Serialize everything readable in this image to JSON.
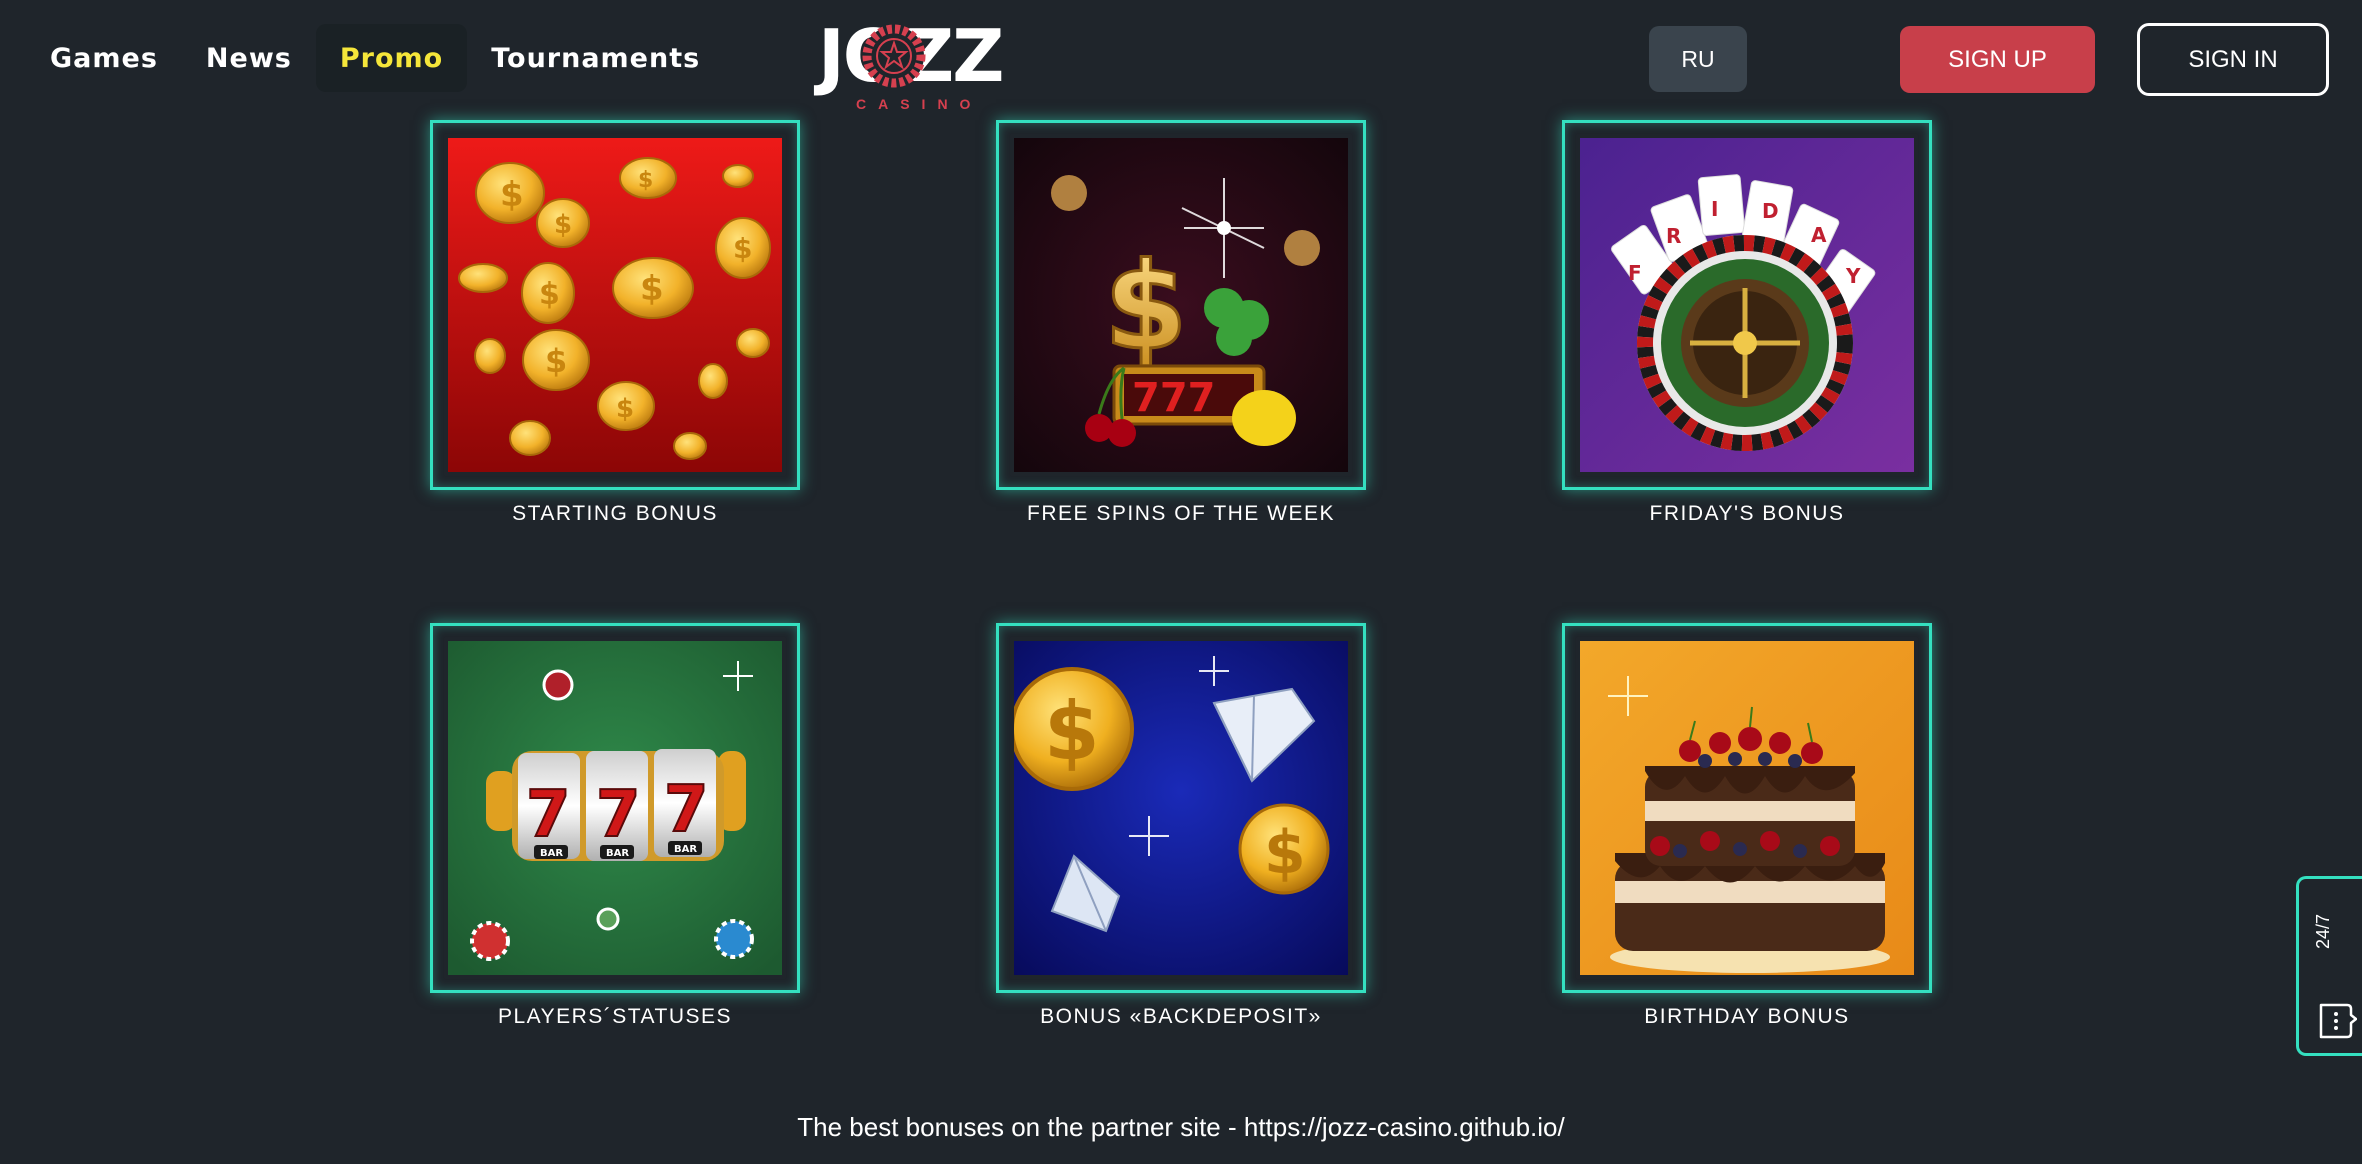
{
  "nav": {
    "items": [
      {
        "label": "Games",
        "active": false
      },
      {
        "label": "News",
        "active": false
      },
      {
        "label": "Promo",
        "active": true
      },
      {
        "label": "Tournaments",
        "active": false
      }
    ]
  },
  "logo": {
    "word": "JOZZ",
    "sub": "CASINO"
  },
  "header": {
    "language_label": "RU",
    "signup_label": "SIGN UP",
    "signin_label": "SIGN IN"
  },
  "promos": [
    {
      "title": "STARTING BONUS",
      "icon": "gold-coins-icon"
    },
    {
      "title": "FREE SPINS OF THE WEEK",
      "icon": "slot-dollar-icon"
    },
    {
      "title": "FRIDAY'S BONUS",
      "icon": "roulette-cards-icon"
    },
    {
      "title": "PLAYERS´STATUSES",
      "icon": "slot-machine-icon"
    },
    {
      "title": "BONUS «BACKDEPOSIT»",
      "icon": "diamonds-coins-icon"
    },
    {
      "title": "BIRTHDAY BONUS",
      "icon": "birthday-cake-icon"
    }
  ],
  "footer": {
    "text": "The best bonuses on the partner site - https://jozz-casino.github.io/"
  },
  "support": {
    "label": "24/7",
    "icon": "chat-icon"
  },
  "colors": {
    "background": "#1f252b",
    "accent_neon": "#34e0c0",
    "signup": "#c83f4a",
    "active_nav": "#f5e63a",
    "language_button": "#3a444d"
  }
}
